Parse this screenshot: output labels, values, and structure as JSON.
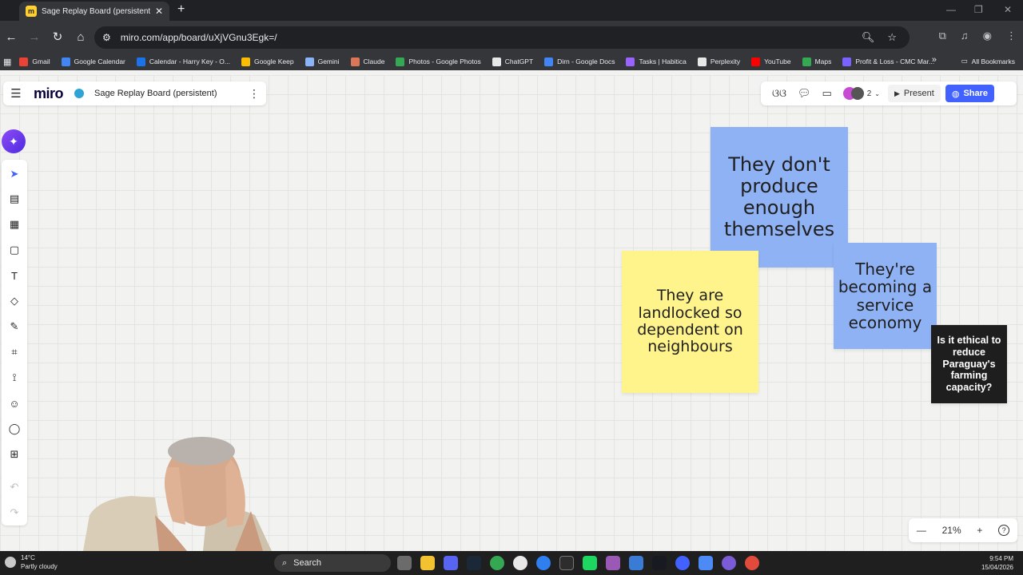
{
  "browser": {
    "tab_title": "Sage Replay Board (persistent) - Miro",
    "tab_close": "✕",
    "new_tab": "+",
    "url": "miro.com/app/board/uXjVGnu3Egk=/",
    "bookmarks": [
      {
        "label": "Gmail",
        "color": "#ea4335"
      },
      {
        "label": "Google Calendar",
        "color": "#4285f4"
      },
      {
        "label": "Calendar - Harry Key - O...",
        "color": "#1a73e8"
      },
      {
        "label": "Google Keep",
        "color": "#fbbc04"
      },
      {
        "label": "Gemini",
        "color": "#8ab4f8"
      },
      {
        "label": "Claude",
        "color": "#d97757"
      },
      {
        "label": "Photos - Google Photos",
        "color": "#34a853"
      },
      {
        "label": "ChatGPT",
        "color": "#e8e8e8"
      },
      {
        "label": "Dirn - Google Docs",
        "color": "#4285f4"
      },
      {
        "label": "Tasks | Habitica",
        "color": "#9a62ff"
      },
      {
        "label": "Perplexity",
        "color": "#e8e8e8"
      },
      {
        "label": "YouTube",
        "color": "#ff0000"
      },
      {
        "label": "Maps",
        "color": "#34a853"
      },
      {
        "label": "Profit & Loss - CMC Mar...",
        "color": "#7b61ff"
      }
    ],
    "bookmarks_more": "»",
    "all_bookmarks": "All Bookmarks"
  },
  "miro": {
    "logo": "miro",
    "board_title": "Sage Replay Board (persistent)",
    "collaborator_count": "2",
    "present_label": "Present",
    "share_label": "Share",
    "zoom": {
      "minus": "—",
      "level": "21%",
      "plus": "+",
      "help": "?"
    }
  },
  "stickies": {
    "blue1": "They don't produce enough themselves",
    "blue2": "They're becoming a service economy",
    "yellow": "They are landlocked so dependent on neighbours",
    "black": "Is it ethical to reduce Paraguay's farming capacity?"
  },
  "colors": {
    "sticky_blue": "#8fb2f5",
    "sticky_yellow": "#fff38c",
    "sticky_black": "#1e1e1e",
    "accent": "#4262ff"
  },
  "taskbar": {
    "weather_temp": "14°C",
    "weather_desc": "Partly cloudy",
    "search_label": "Search",
    "time": "9:54 PM",
    "date": "15/04/2026"
  }
}
